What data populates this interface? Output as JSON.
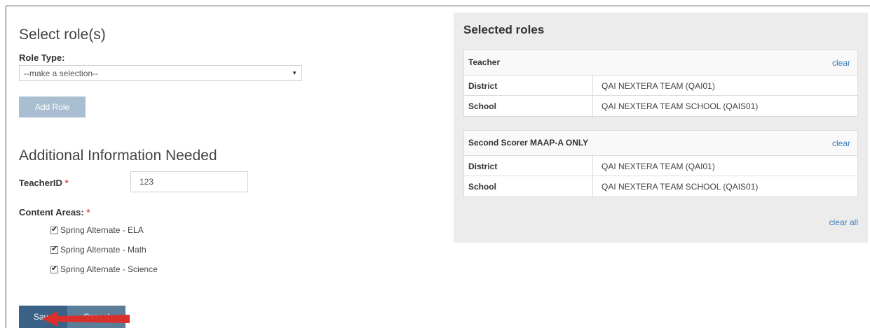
{
  "form": {
    "select_heading": "Select role(s)",
    "role_type_label": "Role Type:",
    "role_type_value": "--make a selection--",
    "add_role_label": "Add Role",
    "additional_heading": "Additional Information Needed",
    "teacher_id_label": "TeacherID",
    "teacher_id_value": "123",
    "content_areas_label": "Content Areas:",
    "required_marker": "*",
    "content_areas": [
      {
        "label": "Spring Alternate - ELA",
        "checked": true
      },
      {
        "label": "Spring Alternate - Math",
        "checked": true
      },
      {
        "label": "Spring Alternate - Science",
        "checked": true
      }
    ],
    "save_label": "Save",
    "cancel_label": "Cancel"
  },
  "selected_roles": {
    "title": "Selected roles",
    "clear_label": "clear",
    "clear_all_label": "clear all",
    "roles": [
      {
        "name": "Teacher",
        "rows": [
          {
            "key": "District",
            "value": "QAI NEXTERA TEAM (QAI01)"
          },
          {
            "key": "School",
            "value": "QAI NEXTERA TEAM SCHOOL (QAIS01)"
          }
        ]
      },
      {
        "name": "Second Scorer MAAP-A ONLY",
        "rows": [
          {
            "key": "District",
            "value": "QAI NEXTERA TEAM (QAI01)"
          },
          {
            "key": "School",
            "value": "QAI NEXTERA TEAM SCHOOL (QAIS01)"
          }
        ]
      }
    ]
  },
  "colors": {
    "annotation_arrow": "#d9302b",
    "link": "#3a7ab8",
    "required": "#d9534f"
  }
}
